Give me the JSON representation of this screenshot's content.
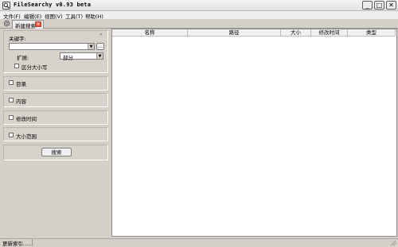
{
  "window": {
    "title": "FileSearchy v0.93 beta",
    "minimize_glyph": "_",
    "maximize_glyph": "□",
    "close_glyph": "✕"
  },
  "menu": {
    "items": [
      {
        "label": "文件(F)"
      },
      {
        "label": "编辑(E)"
      },
      {
        "label": "视图(V)"
      },
      {
        "label": "工具(T)"
      },
      {
        "label": "帮助(H)"
      }
    ]
  },
  "tab": {
    "label": "新建搜索",
    "close_glyph": "✕"
  },
  "search_panel": {
    "collapse_glyph": "«",
    "keyword_label": "关键字:",
    "keyword_value": "",
    "browse_label": "...",
    "ext_label": "扩展:",
    "ext_value": "部分",
    "case_sensitive_label": "区分大小写"
  },
  "filters": [
    {
      "label": "目录"
    },
    {
      "label": "内容"
    },
    {
      "label": "修改时间"
    },
    {
      "label": "大小范围"
    }
  ],
  "search_button_label": "搜索",
  "results": {
    "columns": [
      {
        "label": "名称"
      },
      {
        "label": "路径"
      },
      {
        "label": "大小"
      },
      {
        "label": "修改时间"
      },
      {
        "label": "类型"
      }
    ],
    "rows": []
  },
  "status": {
    "text": "更新索引....."
  },
  "colors": {
    "tab_close": "#e9552f",
    "window_bg": "#d4d0c8"
  }
}
